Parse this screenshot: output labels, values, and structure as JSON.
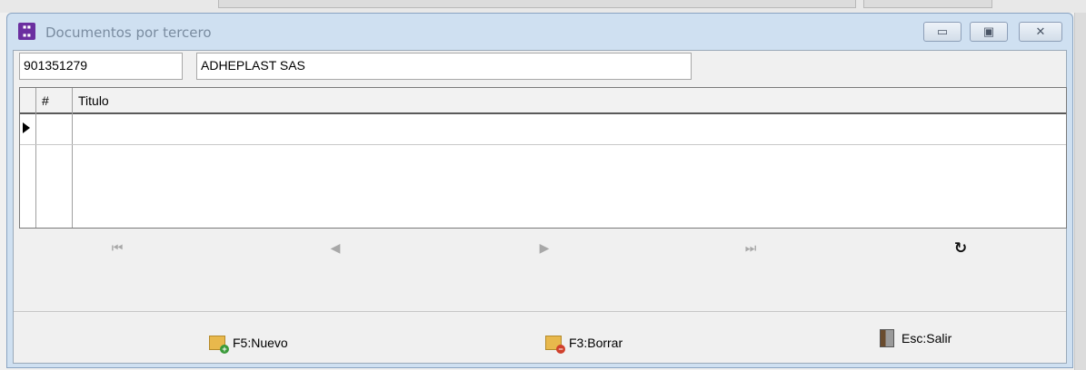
{
  "window": {
    "title": "Documentos por tercero",
    "icon": "app-logo-icon",
    "controls": [
      "minimize-icon",
      "maximize-icon",
      "close-icon"
    ]
  },
  "tercero": {
    "nit": "901351279",
    "nombre": "ADHEPLAST SAS"
  },
  "grid": {
    "columns": [
      "#",
      "Titulo"
    ],
    "rows": []
  },
  "navigator": {
    "buttons": [
      "first-icon",
      "prior-icon",
      "next-icon",
      "last-icon",
      "refresh-icon"
    ]
  },
  "actions": {
    "nuevo": "F5:Nuevo",
    "borrar": "F3:Borrar",
    "salir": "Esc:Salir"
  },
  "colors": {
    "title_text": "#7a8ca0",
    "frame": "#cfe0f1",
    "app_icon": "#6b2fa0"
  }
}
